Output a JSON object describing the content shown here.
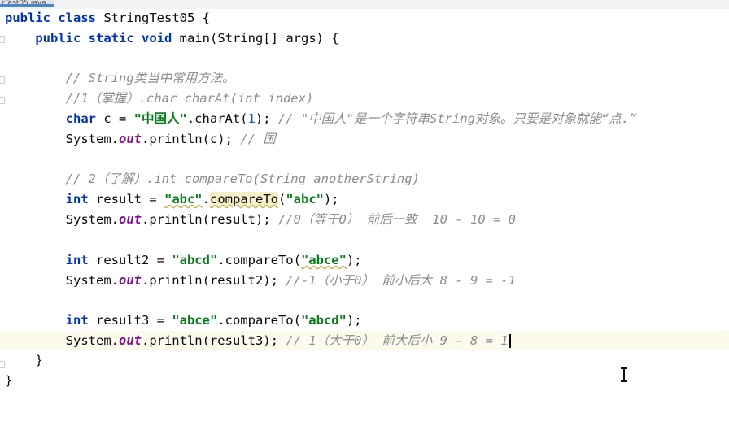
{
  "tab": {
    "label": "rTest05.java"
  },
  "code": {
    "l1": {
      "kw1": "public",
      "kw2": "class",
      "rest": " StringTest05 {"
    },
    "l2": {
      "kw1": "public",
      "kw2": "static",
      "kw3": "void",
      "rest": " main(String[] args) {"
    },
    "l3": {
      "comment": "// String类当中常用方法。"
    },
    "l4": {
      "comment": "//1（掌握）.char charAt(int index)"
    },
    "l5": {
      "kw": "char",
      "a": " c = ",
      "s": "\"中国人\"",
      "b": ".charAt(",
      "n": "1",
      "c": "); ",
      "comment": "// \"中国人\"是一个字符串String对象。只要是对象就能“点.”"
    },
    "l6": {
      "a": "System.",
      "f": "out",
      "b": ".println(c); ",
      "comment": "// 国"
    },
    "l7": {
      "comment": "// 2（了解）.int compareTo(String anotherString)"
    },
    "l8": {
      "kw": "int",
      "a": " result = ",
      "s1": "\"abc\"",
      "dot": ".",
      "m": "compareTo",
      "p": "(",
      "s2": "\"abc\"",
      "c": ");"
    },
    "l9": {
      "a": "System.",
      "f": "out",
      "b": ".println(result); ",
      "comment": "//0（等于0） 前后一致  10 - 10 = 0"
    },
    "l10": {
      "kw": "int",
      "a": " result2 = ",
      "s1": "\"abcd\"",
      "b": ".compareTo(",
      "s2": "\"abce\"",
      "c": ");"
    },
    "l11": {
      "a": "System.",
      "f": "out",
      "b": ".println(result2); ",
      "comment": "//-1（小于0） 前小后大 8 - 9 = -1"
    },
    "l12": {
      "kw": "int",
      "a": " result3 = ",
      "s1": "\"abce\"",
      "b": ".compareTo(",
      "s2": "\"abcd\"",
      "c": ");"
    },
    "l13": {
      "a": "System.",
      "f": "out",
      "b": ".println(result3); ",
      "comment": "// 1（大于0） 前大后小 9 - 8 = 1"
    },
    "l14": {
      "text": "}"
    },
    "l15": {
      "text": "}"
    }
  }
}
